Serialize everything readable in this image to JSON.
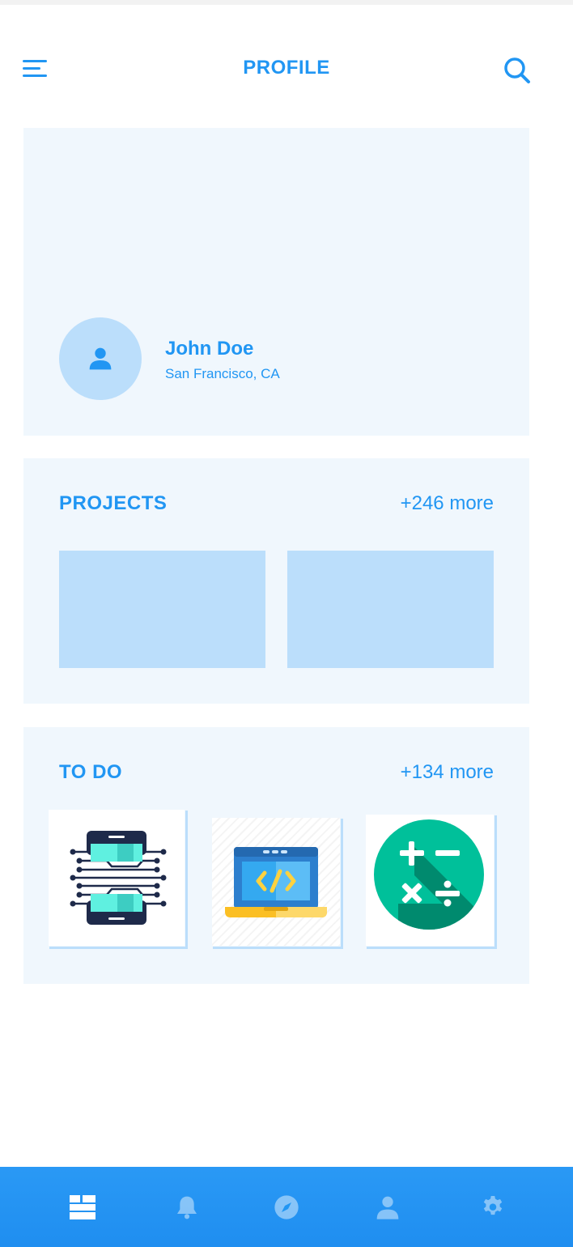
{
  "header": {
    "title": "PROFILE",
    "menu_icon": "menu-icon",
    "search_icon": "search-icon"
  },
  "profile": {
    "name": "John Doe",
    "location": "San Francisco, CA",
    "avatar_icon": "user-icon"
  },
  "projects": {
    "title": "PROJECTS",
    "more": "+246 more"
  },
  "todo": {
    "title": "TO DO",
    "more": "+134 more",
    "items": [
      {
        "icon": "mobile-circuit-icon"
      },
      {
        "icon": "laptop-code-icon"
      },
      {
        "icon": "math-operations-icon"
      }
    ]
  },
  "bottom_nav": {
    "items": [
      {
        "icon": "dashboard-icon",
        "active": true
      },
      {
        "icon": "bell-icon",
        "active": false
      },
      {
        "icon": "compass-icon",
        "active": false
      },
      {
        "icon": "user-icon",
        "active": false
      },
      {
        "icon": "gear-icon",
        "active": false
      }
    ]
  },
  "colors": {
    "accent": "#2196f3",
    "card_bg": "#f0f7fd",
    "placeholder": "#bbdefb",
    "nav_bg": "#2196f3"
  }
}
